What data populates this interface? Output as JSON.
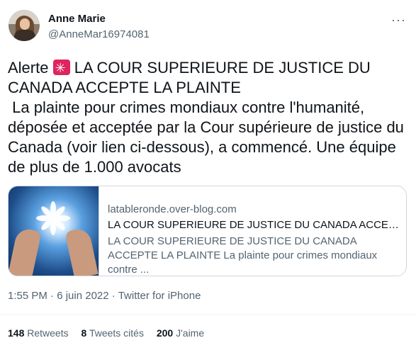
{
  "user": {
    "name": "Anne Marie",
    "handle": "@AnneMar16974081"
  },
  "menu_icon": "more-horizontal-icon",
  "tweet": {
    "prefix": "Alerte ",
    "emoji_icon": "police-siren-icon",
    "text": " LA COUR SUPERIEURE DE JUSTICE DU CANADA ACCEPTE LA PLAINTE\n La plainte pour crimes mondiaux contre l'humanité, déposée et acceptée par la Cour supérieure de justice du Canada (voir lien ci-dessous), a commencé. Une équipe de plus de 1.000 avocats"
  },
  "card": {
    "domain": "latableronde.over-blog.com",
    "title": "LA COUR SUPERIEURE DE JUSTICE DU CANADA ACCEPT...",
    "description": "LA COUR SUPERIEURE DE JUSTICE DU CANADA ACCEPTE LA PLAINTE La plainte pour crimes mondiaux contre ..."
  },
  "meta": {
    "time": "1:55 PM",
    "sep1": " · ",
    "date": "6 juin 2022",
    "sep2": " · ",
    "source": "Twitter for iPhone"
  },
  "stats": [
    {
      "count": "148",
      "label": "Retweets"
    },
    {
      "count": "8",
      "label": "Tweets cités"
    },
    {
      "count": "200",
      "label": "J'aime"
    }
  ]
}
